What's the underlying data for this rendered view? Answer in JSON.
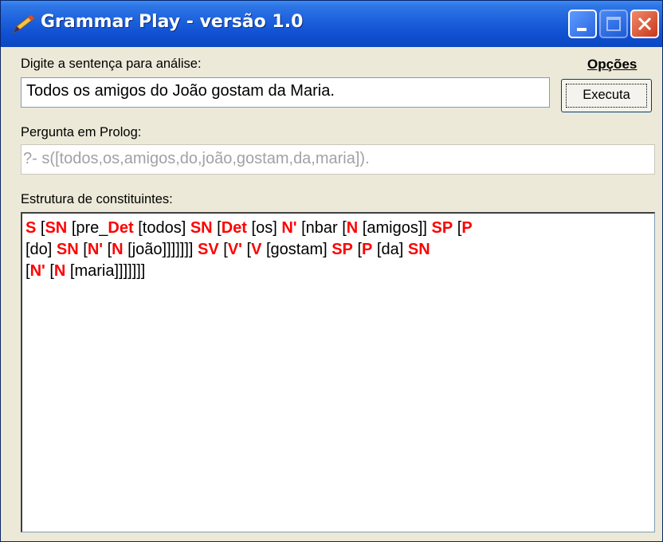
{
  "window": {
    "title": "Grammar Play - versão 1.0",
    "icon": "app-pen-icon",
    "controls": [
      "minimize-icon",
      "maximize-icon",
      "close-icon"
    ]
  },
  "sentence_section": {
    "label": "Digite a sentença para análise:",
    "value": "Todos os amigos do João gostam da Maria.",
    "options_label": "Opções",
    "execute_button": "Executa"
  },
  "prolog_section": {
    "label": "Pergunta em Prolog:",
    "value": "?- s([todos,os,amigos,do,joão,gostam,da,maria])."
  },
  "structure_section": {
    "label": "Estrutura de constituintes:",
    "lines": [
      [
        {
          "t": "S",
          "c": "cat"
        },
        {
          "t": " [",
          "c": "word"
        },
        {
          "t": "SN",
          "c": "cat"
        },
        {
          "t": " [pre_",
          "c": "word"
        },
        {
          "t": "Det",
          "c": "cat"
        },
        {
          "t": " [todos]  ",
          "c": "word"
        },
        {
          "t": "SN",
          "c": "cat"
        },
        {
          "t": " [",
          "c": "word"
        },
        {
          "t": "Det",
          "c": "cat"
        },
        {
          "t": " [os]  ",
          "c": "word"
        },
        {
          "t": "N'",
          "c": "cat"
        },
        {
          "t": " [nbar  [",
          "c": "word"
        },
        {
          "t": "N",
          "c": "cat"
        },
        {
          "t": " [amigos]]  ",
          "c": "word"
        },
        {
          "t": "SP",
          "c": "cat"
        },
        {
          "t": " [",
          "c": "word"
        },
        {
          "t": "P",
          "c": "cat"
        }
      ],
      [
        {
          "t": "[do]  ",
          "c": "word"
        },
        {
          "t": "SN",
          "c": "cat"
        },
        {
          "t": " [",
          "c": "word"
        },
        {
          "t": "N'",
          "c": "cat"
        },
        {
          "t": " [",
          "c": "word"
        },
        {
          "t": "N",
          "c": "cat"
        },
        {
          "t": " [joão]]]]]]]  ",
          "c": "word"
        },
        {
          "t": "SV",
          "c": "cat"
        },
        {
          "t": " [",
          "c": "word"
        },
        {
          "t": "V'",
          "c": "cat"
        },
        {
          "t": " [",
          "c": "word"
        },
        {
          "t": "V",
          "c": "cat"
        },
        {
          "t": " [gostam]  ",
          "c": "word"
        },
        {
          "t": "SP",
          "c": "cat"
        },
        {
          "t": " [",
          "c": "word"
        },
        {
          "t": "P",
          "c": "cat"
        },
        {
          "t": " [da]  ",
          "c": "word"
        },
        {
          "t": "SN",
          "c": "cat"
        }
      ],
      [
        {
          "t": "[",
          "c": "word"
        },
        {
          "t": "N'",
          "c": "cat"
        },
        {
          "t": " [",
          "c": "word"
        },
        {
          "t": "N",
          "c": "cat"
        },
        {
          "t": " [maria]]]]]]]",
          "c": "word"
        }
      ]
    ]
  },
  "colors": {
    "title_bar": "#1c5fdc",
    "category": "#ff0000",
    "disabled_text": "#a2a2a2",
    "window_face": "#ece9d8"
  }
}
